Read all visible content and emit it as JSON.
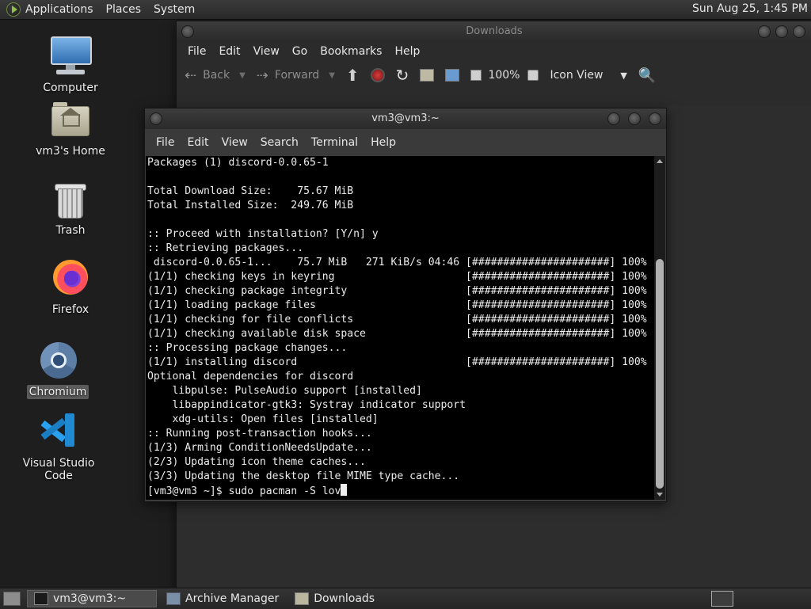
{
  "top_panel": {
    "menus": [
      "Applications",
      "Places",
      "System"
    ],
    "clock": "Sun Aug 25,  1:45 PM",
    "logo_icon": "distro-logo-icon"
  },
  "desktop_icons": [
    {
      "label": "Computer",
      "icon": "computer-icon"
    },
    {
      "label": "vm3's Home",
      "icon": "home-folder-icon"
    },
    {
      "label": "Trash",
      "icon": "trash-icon"
    },
    {
      "label": "Firefox",
      "icon": "firefox-icon"
    },
    {
      "label": "Chromium",
      "icon": "chromium-icon",
      "selected": true
    },
    {
      "label": "Visual Studio Code",
      "icon": "vscode-icon"
    }
  ],
  "file_manager": {
    "title": "Downloads",
    "menu": [
      "File",
      "Edit",
      "View",
      "Go",
      "Bookmarks",
      "Help"
    ],
    "toolbar": {
      "back": "Back",
      "forward": "Forward",
      "zoom": "100%",
      "view_mode": "Icon View"
    }
  },
  "terminal": {
    "title": "vm3@vm3:~",
    "menu": [
      "File",
      "Edit",
      "View",
      "Search",
      "Terminal",
      "Help"
    ],
    "lines": [
      "Packages (1) discord-0.0.65-1",
      "",
      "Total Download Size:    75.67 MiB",
      "Total Installed Size:  249.76 MiB",
      "",
      ":: Proceed with installation? [Y/n] y",
      ":: Retrieving packages...",
      " discord-0.0.65-1...    75.7 MiB   271 KiB/s 04:46 [######################] 100%",
      "(1/1) checking keys in keyring                     [######################] 100%",
      "(1/1) checking package integrity                   [######################] 100%",
      "(1/1) loading package files                        [######################] 100%",
      "(1/1) checking for file conflicts                  [######################] 100%",
      "(1/1) checking available disk space                [######################] 100%",
      ":: Processing package changes...",
      "(1/1) installing discord                           [######################] 100%",
      "Optional dependencies for discord",
      "    libpulse: PulseAudio support [installed]",
      "    libappindicator-gtk3: Systray indicator support",
      "    xdg-utils: Open files [installed]",
      ":: Running post-transaction hooks...",
      "(1/3) Arming ConditionNeedsUpdate...",
      "(2/3) Updating icon theme caches...",
      "(3/3) Updating the desktop file MIME type cache..."
    ],
    "prompt": "[vm3@vm3 ~]$ sudo pacman -S lov"
  },
  "taskbar": {
    "tasks": [
      {
        "label": "vm3@vm3:~",
        "active": true,
        "icon": "terminal-icon"
      },
      {
        "label": "Archive Manager",
        "active": false,
        "icon": "archive-icon"
      },
      {
        "label": "Downloads",
        "active": false,
        "icon": "folder-icon"
      }
    ]
  }
}
